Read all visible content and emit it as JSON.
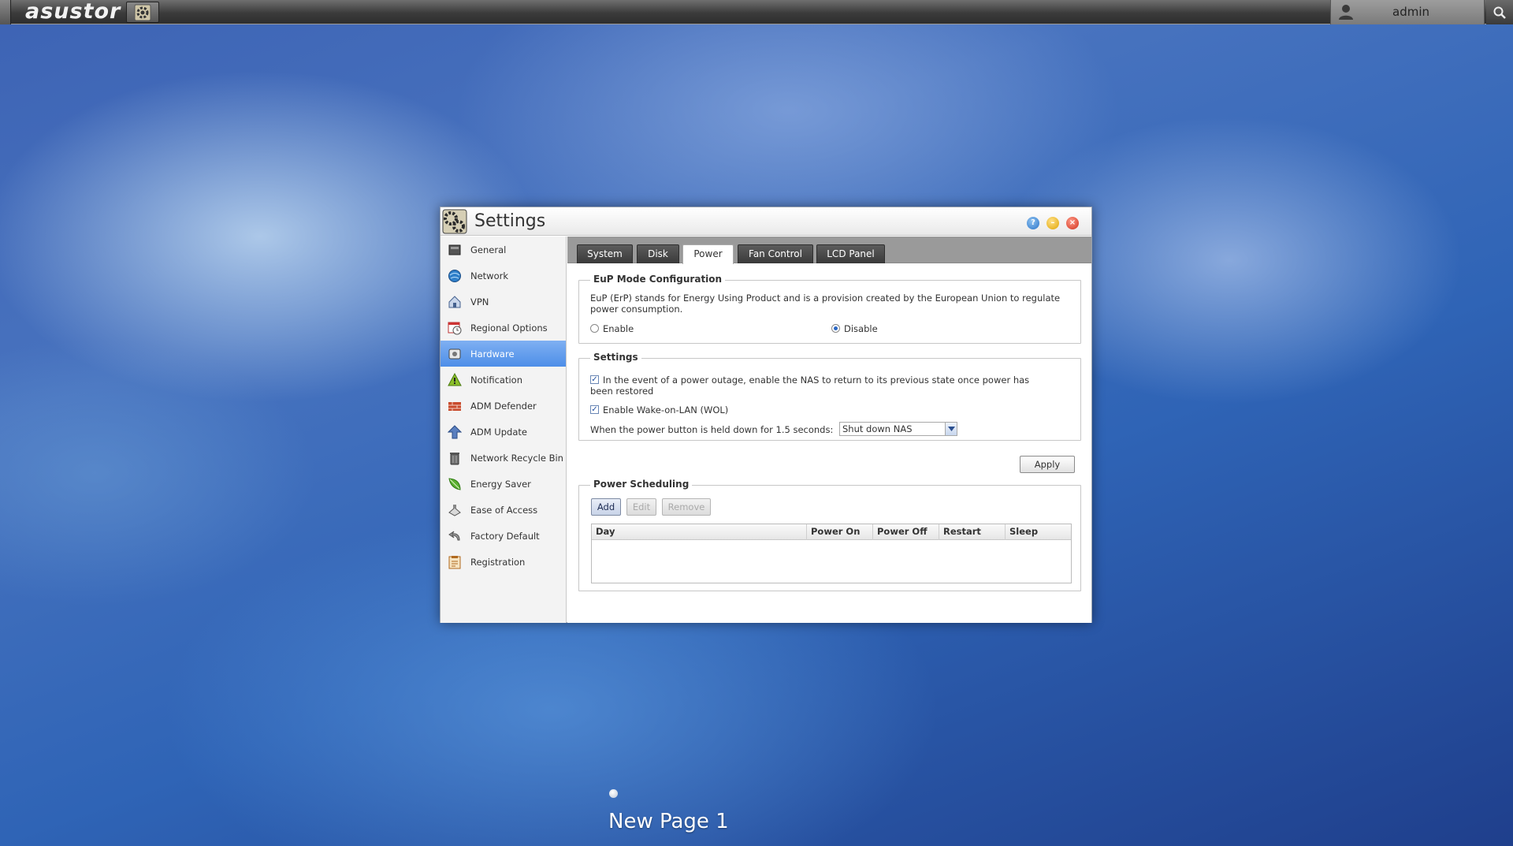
{
  "taskbar": {
    "brand": "asustor",
    "username": "admin"
  },
  "window": {
    "title": "Settings",
    "buttons": {
      "help": "?",
      "minimize": "–",
      "close": "×"
    }
  },
  "sidebar": {
    "items": [
      {
        "label": "General",
        "icon": "general-icon"
      },
      {
        "label": "Network",
        "icon": "network-icon"
      },
      {
        "label": "VPN",
        "icon": "vpn-icon"
      },
      {
        "label": "Regional Options",
        "icon": "regional-options-icon"
      },
      {
        "label": "Hardware",
        "icon": "hardware-icon",
        "active": true
      },
      {
        "label": "Notification",
        "icon": "notification-icon"
      },
      {
        "label": "ADM Defender",
        "icon": "adm-defender-icon"
      },
      {
        "label": "ADM Update",
        "icon": "adm-update-icon"
      },
      {
        "label": "Network Recycle Bin",
        "icon": "recycle-bin-icon"
      },
      {
        "label": "Energy Saver",
        "icon": "energy-saver-icon"
      },
      {
        "label": "Ease of Access",
        "icon": "ease-of-access-icon"
      },
      {
        "label": "Factory Default",
        "icon": "factory-default-icon"
      },
      {
        "label": "Registration",
        "icon": "registration-icon"
      }
    ]
  },
  "tabs": [
    {
      "label": "System"
    },
    {
      "label": "Disk"
    },
    {
      "label": "Power",
      "active": true
    },
    {
      "label": "Fan Control"
    },
    {
      "label": "LCD Panel"
    }
  ],
  "eup": {
    "legend": "EuP Mode Configuration",
    "description_line1": "EuP (ErP) stands for Energy Using Product and is a provision created by the European Union to regulate",
    "description_line2": "power consumption.",
    "enable_label": "Enable",
    "disable_label": "Disable",
    "selected": "Disable"
  },
  "settings": {
    "legend": "Settings",
    "restore_label_line1": "In the event of a power outage, enable the NAS to return to its previous state once power has",
    "restore_label_line2": "been restored",
    "restore_checked": true,
    "wol_label": "Enable Wake-on-LAN (WOL)",
    "wol_checked": true,
    "power_button_label": "When the power button is held down for 1.5 seconds:",
    "power_button_value": "Shut down NAS"
  },
  "apply_label": "Apply",
  "scheduling": {
    "legend": "Power Scheduling",
    "add_label": "Add",
    "edit_label": "Edit",
    "remove_label": "Remove",
    "columns": [
      "Day",
      "Power On",
      "Power Off",
      "Restart",
      "Sleep"
    ]
  },
  "desktop": {
    "page_label": "New Page 1"
  },
  "colors": {
    "active_sidebar": "#5a97ea",
    "tab_dark": "#3f3f3f",
    "accent_blue": "#2a67c4"
  }
}
